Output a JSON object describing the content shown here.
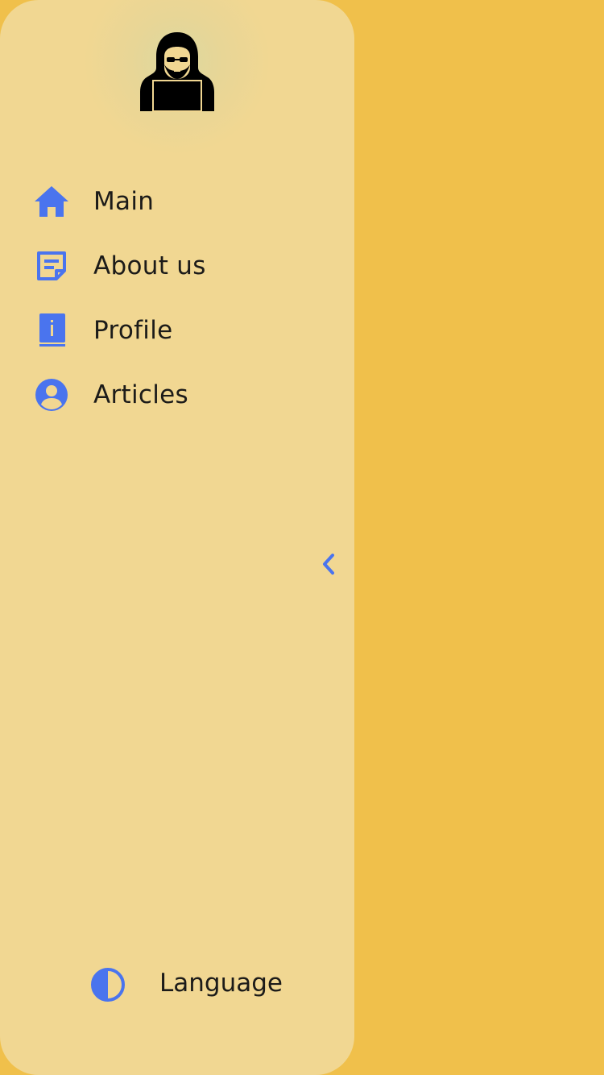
{
  "colors": {
    "background": "#f0c04b",
    "drawer": "#f1d792",
    "accent": "#4a74ee",
    "text": "#1c1b19"
  },
  "avatar": {
    "icon": "hacker-avatar-icon"
  },
  "nav": {
    "items": [
      {
        "label": "Main",
        "icon": "home-icon"
      },
      {
        "label": "About us",
        "icon": "note-icon"
      },
      {
        "label": "Profile",
        "icon": "info-book-icon"
      },
      {
        "label": "Articles",
        "icon": "user-circle-icon"
      }
    ]
  },
  "collapse": {
    "icon": "chevron-left-icon"
  },
  "language": {
    "label": "Language",
    "icon": "contrast-half-circle-icon"
  }
}
